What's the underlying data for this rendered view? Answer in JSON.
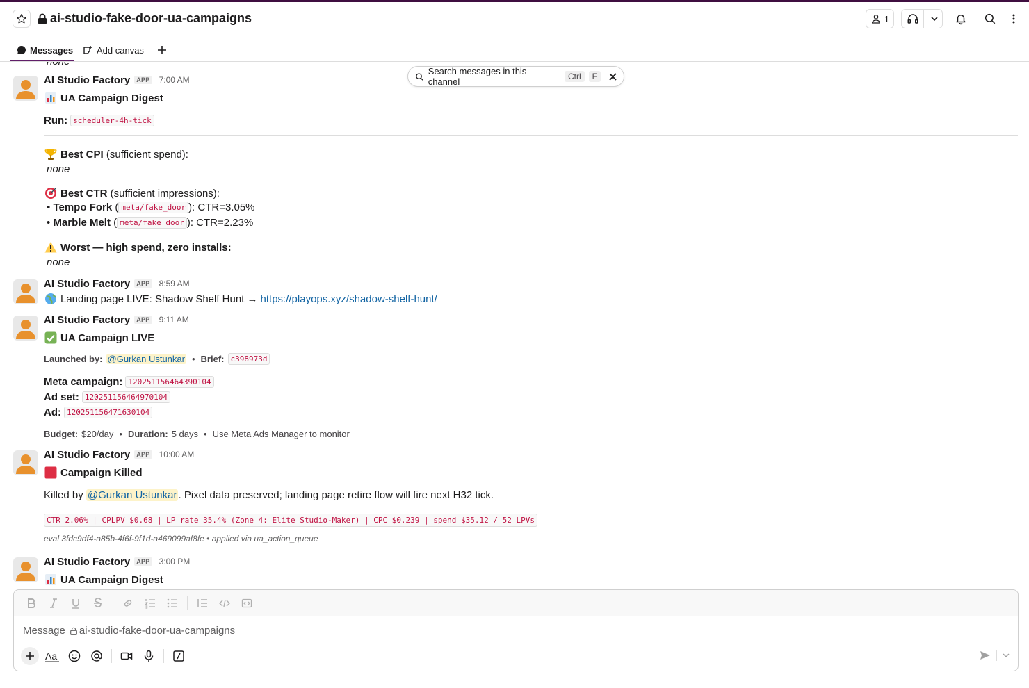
{
  "header": {
    "channel_name": "ai-studio-fake-door-ua-campaigns",
    "member_count": "1"
  },
  "tabs": [
    {
      "label": "Messages"
    },
    {
      "label": "Add canvas"
    }
  ],
  "search": {
    "placeholder": "Search messages in this channel",
    "kbd_ctrl": "Ctrl",
    "kbd_f": "F"
  },
  "cutoff_text": "none",
  "messages": [
    {
      "author": "AI Studio Factory",
      "badge": "APP",
      "time": "7:00 AM",
      "title": "UA Campaign Digest",
      "run_label": "Run:",
      "run_value": "scheduler-4h-tick",
      "best_cpi_label": "Best CPI",
      "best_cpi_suffix": " (sufficient spend):",
      "best_cpi_value": "none",
      "best_ctr_label": "Best CTR",
      "best_ctr_suffix": " (sufficient impressions):",
      "ctr_items": [
        {
          "bullet": "•",
          "name": "Tempo Fork",
          "open": " (",
          "code": "meta/fake_door",
          "tail": "): CTR=3.05%"
        },
        {
          "bullet": "•",
          "name": "Marble Melt",
          "open": " (",
          "code": "meta/fake_door",
          "tail": "): CTR=2.23%"
        }
      ],
      "worst_label": "Worst — high spend, zero installs:",
      "worst_value": "none"
    },
    {
      "author": "AI Studio Factory",
      "badge": "APP",
      "time": "8:59 AM",
      "text": "Landing page LIVE: Shadow Shelf Hunt →",
      "link": "https://playops.xyz/shadow-shelf-hunt/"
    },
    {
      "author": "AI Studio Factory",
      "badge": "APP",
      "time": "9:11 AM",
      "title": "UA Campaign LIVE",
      "launched_label": "Launched by:",
      "launched_by": "@Gurkan Ustunkar",
      "sep": "•",
      "brief_label": "Brief:",
      "brief": "c398973d",
      "meta_campaign_label": "Meta campaign:",
      "meta_campaign": "120251156464390104",
      "ad_set_label": "Ad set:",
      "ad_set": "120251156464970104",
      "ad_label": "Ad:",
      "ad": "120251156471630104",
      "budget_label": "Budget:",
      "budget": "$20/day",
      "duration_label": "Duration:",
      "duration": "5 days",
      "monitor": "Use Meta Ads Manager to monitor"
    },
    {
      "author": "AI Studio Factory",
      "badge": "APP",
      "time": "10:00 AM",
      "title": "Campaign Killed",
      "killed_prefix": "Killed by",
      "killed_by": "@Gurkan Ustunkar",
      "killed_suffix": ". Pixel data preserved; landing page retire flow will fire next H32 tick.",
      "metrics": "CTR 2.06% | CPLPV $0.68 | LP rate 35.4% (Zone 4: Elite Studio-Maker) | CPC $0.239 | spend $35.12 / 52 LPVs",
      "eval": "eval 3fdc9df4-a85b-4f6f-9f1d-a469099af8fe • applied via ua_action_queue"
    },
    {
      "author": "AI Studio Factory",
      "badge": "APP",
      "time": "3:00 PM",
      "title": "UA Campaign Digest"
    }
  ],
  "composer": {
    "placeholder_prefix": "Message",
    "channel": "ai-studio-fake-door-ua-campaigns"
  },
  "colors": {
    "accent": "#611f69",
    "link": "#1264a3",
    "code": "#c01343",
    "mention_bg": "#fdf3c9",
    "avatar": "#e8912d"
  }
}
